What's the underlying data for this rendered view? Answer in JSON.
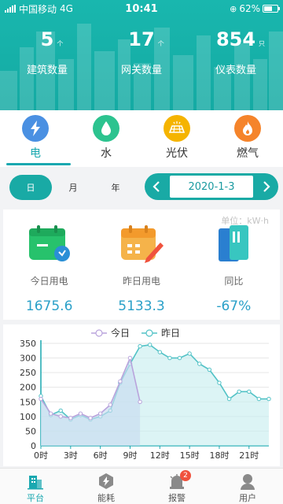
{
  "status_bar": {
    "carrier": "中国移动",
    "network": "4G",
    "time": "10:41",
    "battery": "62%",
    "battery_level": 0.62
  },
  "stats": [
    {
      "value": "5",
      "unit": "个",
      "label": "建筑数量"
    },
    {
      "value": "17",
      "unit": "个",
      "label": "网关数量"
    },
    {
      "value": "854",
      "unit": "只",
      "label": "仪表数量"
    }
  ],
  "type_tabs": [
    {
      "label": "电",
      "icon": "lightning-icon",
      "color": "#4a90e2"
    },
    {
      "label": "水",
      "icon": "water-drop-icon",
      "color": "#2cc38f"
    },
    {
      "label": "光伏",
      "icon": "solar-panel-icon",
      "color": "#f5b400"
    },
    {
      "label": "燃气",
      "icon": "flame-icon",
      "color": "#f5842b"
    }
  ],
  "period": {
    "options": [
      "日",
      "月",
      "年"
    ],
    "active": "日"
  },
  "date": {
    "value": "2020-1-3",
    "prev": "‹",
    "next": "›"
  },
  "summary": {
    "unit": "单位：kW·h",
    "items": [
      {
        "label": "今日用电",
        "value": "1675.6",
        "icon": "calendar-check-icon"
      },
      {
        "label": "昨日用电",
        "value": "5133.3",
        "icon": "calendar-edit-icon"
      },
      {
        "label": "同比",
        "value": "-67%",
        "icon": "compare-icon"
      }
    ]
  },
  "chart_data": {
    "type": "line",
    "legend": [
      "今日",
      "昨日"
    ],
    "legend_position": "top-center",
    "ylim": [
      0,
      350
    ],
    "yticks": [
      "0",
      "50",
      "100",
      "150",
      "200",
      "250",
      "300",
      "350"
    ],
    "x_tick_labels": [
      "0时",
      "3时",
      "6时",
      "9时",
      "12时",
      "15时",
      "18时",
      "21时"
    ],
    "series": [
      {
        "name": "今日",
        "color": "#b9a3dc",
        "fill": "#c7dcef",
        "x": [
          0,
          1,
          2,
          3,
          4,
          5,
          6,
          7,
          8,
          9,
          10
        ],
        "values": [
          160,
          110,
          100,
          95,
          110,
          95,
          110,
          140,
          220,
          300,
          150
        ]
      },
      {
        "name": "昨日",
        "color": "#52c2c6",
        "fill": "#c9eef0",
        "x": [
          0,
          1,
          2,
          3,
          4,
          5,
          6,
          7,
          8,
          9,
          10,
          11,
          12,
          13,
          14,
          15,
          16,
          17,
          18,
          19,
          20,
          21,
          22,
          23
        ],
        "values": [
          170,
          105,
          120,
          90,
          105,
          90,
          100,
          120,
          215,
          280,
          340,
          345,
          320,
          300,
          300,
          315,
          280,
          260,
          215,
          160,
          185,
          185,
          160,
          160
        ]
      }
    ]
  },
  "bottom_nav": [
    {
      "label": "平台",
      "icon": "building-icon"
    },
    {
      "label": "能耗",
      "icon": "energy-icon"
    },
    {
      "label": "报警",
      "icon": "alarm-icon",
      "badge": "2"
    },
    {
      "label": "用户",
      "icon": "user-icon"
    }
  ]
}
